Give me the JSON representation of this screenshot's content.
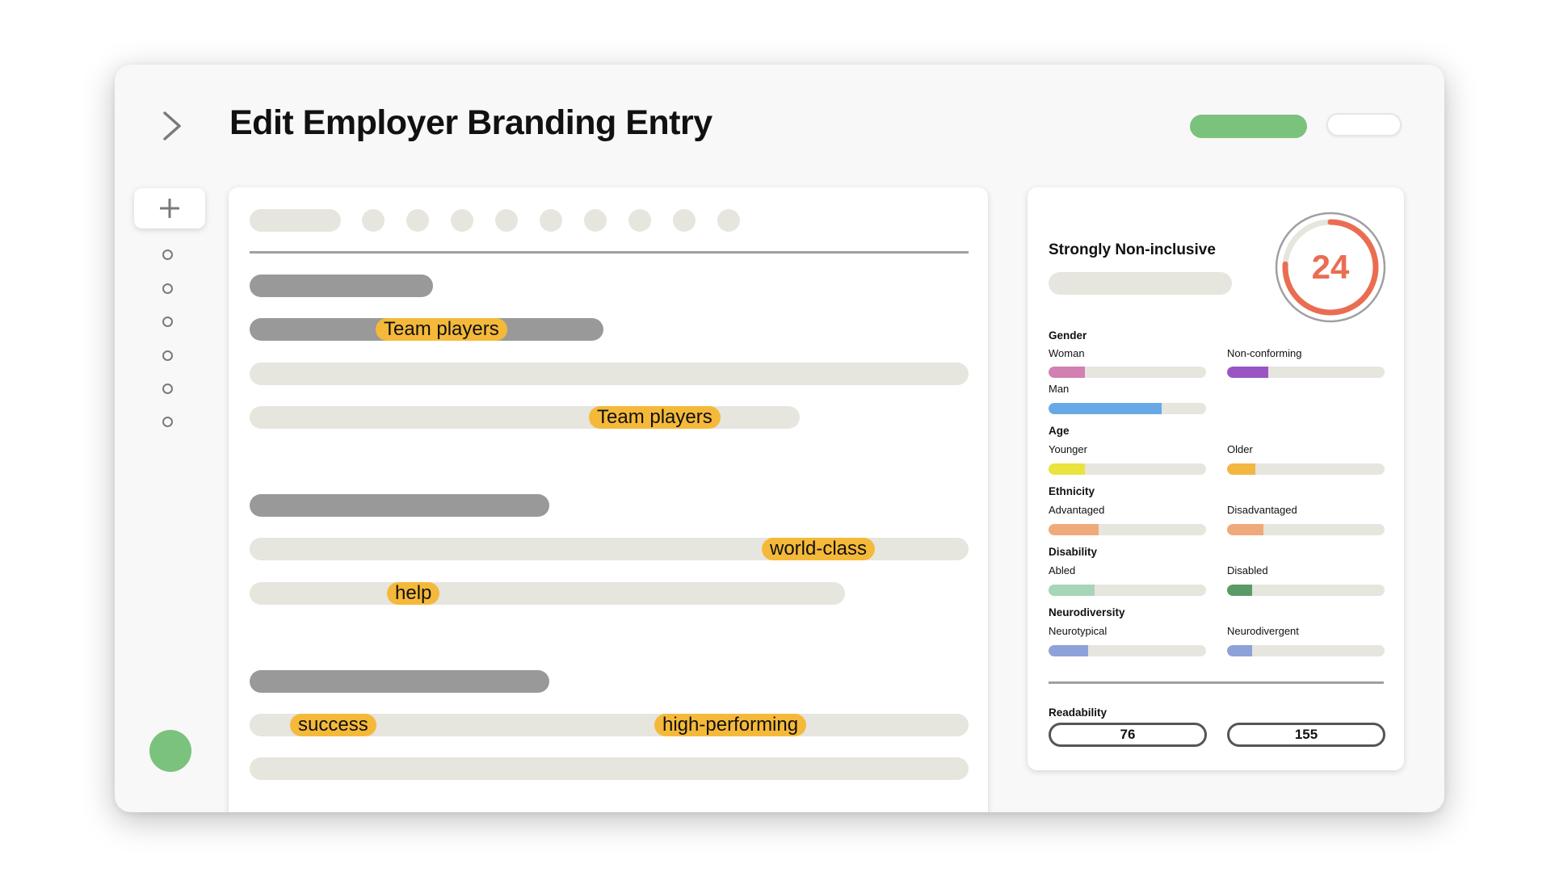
{
  "header": {
    "title": "Edit Employer Branding Entry"
  },
  "sidebar": {
    "add_icon": "plus-icon",
    "nav_dots": 6
  },
  "editor": {
    "toolbar_buttons": 9,
    "highlights": [
      "Team players",
      "Team players",
      "world-class",
      "help",
      "success",
      "high-performing"
    ]
  },
  "score": {
    "rating_label": "Strongly Non-inclusive",
    "value": "24",
    "fraction": 0.76,
    "color": "#ea6d52"
  },
  "metrics": {
    "gender": {
      "label": "Gender",
      "woman": {
        "label": "Woman",
        "fraction": 0.23,
        "color": "#d27fb2"
      },
      "non_conforming": {
        "label": "Non-conforming",
        "fraction": 0.26,
        "color": "#9b55c2"
      },
      "man": {
        "label": "Man",
        "fraction": 0.72,
        "color": "#67a9e6"
      }
    },
    "age": {
      "label": "Age",
      "younger": {
        "label": "Younger",
        "fraction": 0.23,
        "color": "#e9e33d"
      },
      "older": {
        "label": "Older",
        "fraction": 0.18,
        "color": "#f2b740"
      }
    },
    "ethnicity": {
      "label": "Ethnicity",
      "advantaged": {
        "label": "Advantaged",
        "fraction": 0.32,
        "color": "#f0a97a"
      },
      "disadvantaged": {
        "label": "Disadvantaged",
        "fraction": 0.23,
        "color": "#f0a97a"
      }
    },
    "disability": {
      "label": "Disability",
      "abled": {
        "label": "Abled",
        "fraction": 0.29,
        "color": "#a6d5b8"
      },
      "disabled": {
        "label": "Disabled",
        "fraction": 0.16,
        "color": "#5a9a66"
      }
    },
    "neurodiversity": {
      "label": "Neurodiversity",
      "neurotypical": {
        "label": "Neurotypical",
        "fraction": 0.25,
        "color": "#8ea1d9"
      },
      "neurodivergent": {
        "label": "Neurodivergent",
        "fraction": 0.16,
        "color": "#8ea1d9"
      }
    }
  },
  "readability": {
    "label": "Readability",
    "values": [
      "76",
      "155"
    ]
  }
}
